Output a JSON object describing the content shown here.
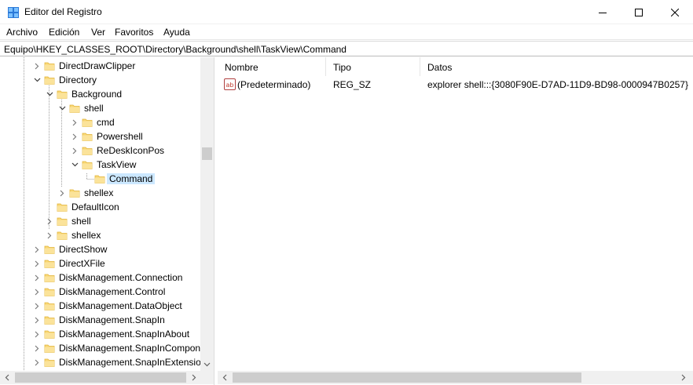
{
  "window": {
    "title": "Editor del Registro"
  },
  "menu": [
    {
      "label": "Archivo"
    },
    {
      "label": "Edición"
    },
    {
      "label": "Ver"
    },
    {
      "label": "Favoritos"
    },
    {
      "label": "Ayuda"
    }
  ],
  "address": {
    "path": "Equipo\\HKEY_CLASSES_ROOT\\Directory\\Background\\shell\\TaskView\\Command"
  },
  "tree": [
    {
      "label": "DirectDrawClipper",
      "expander": "collapsed"
    },
    {
      "label": "Directory",
      "expander": "expanded"
    },
    {
      "label": "Background",
      "expander": "expanded"
    },
    {
      "label": "shell",
      "expander": "expanded"
    },
    {
      "label": "cmd",
      "expander": "collapsed"
    },
    {
      "label": "Powershell",
      "expander": "collapsed"
    },
    {
      "label": "ReDeskIconPos",
      "expander": "collapsed"
    },
    {
      "label": "TaskView",
      "expander": "expanded"
    },
    {
      "label": "Command",
      "expander": "none",
      "selected": true
    },
    {
      "label": "shellex",
      "expander": "collapsed"
    },
    {
      "label": "DefaultIcon",
      "expander": "none"
    },
    {
      "label": "shell",
      "expander": "collapsed"
    },
    {
      "label": "shellex",
      "expander": "collapsed"
    },
    {
      "label": "DirectShow",
      "expander": "collapsed"
    },
    {
      "label": "DirectXFile",
      "expander": "collapsed"
    },
    {
      "label": "DiskManagement.Connection",
      "expander": "collapsed"
    },
    {
      "label": "DiskManagement.Control",
      "expander": "collapsed"
    },
    {
      "label": "DiskManagement.DataObject",
      "expander": "collapsed"
    },
    {
      "label": "DiskManagement.SnapIn",
      "expander": "collapsed"
    },
    {
      "label": "DiskManagement.SnapInAbout",
      "expander": "collapsed"
    },
    {
      "label": "DiskManagement.SnapInCompon",
      "expander": "collapsed"
    },
    {
      "label": "DiskManagement.SnapInExtension",
      "expander": "collapsed"
    }
  ],
  "columns": {
    "name": "Nombre",
    "type": "Tipo",
    "data": "Datos"
  },
  "values": [
    {
      "icon": "reg-sz-ab-icon",
      "name": "(Predeterminado)",
      "type": "REG_SZ",
      "data": "explorer shell:::{3080F90E-D7AD-11D9-BD98-0000947B0257}"
    }
  ],
  "colors": {
    "selection": "#cce8ff",
    "folder": "#f8d775",
    "folder_dark": "#e2b53c",
    "scroll_track": "#f0f0f0",
    "scroll_thumb": "#cdcdcd"
  }
}
